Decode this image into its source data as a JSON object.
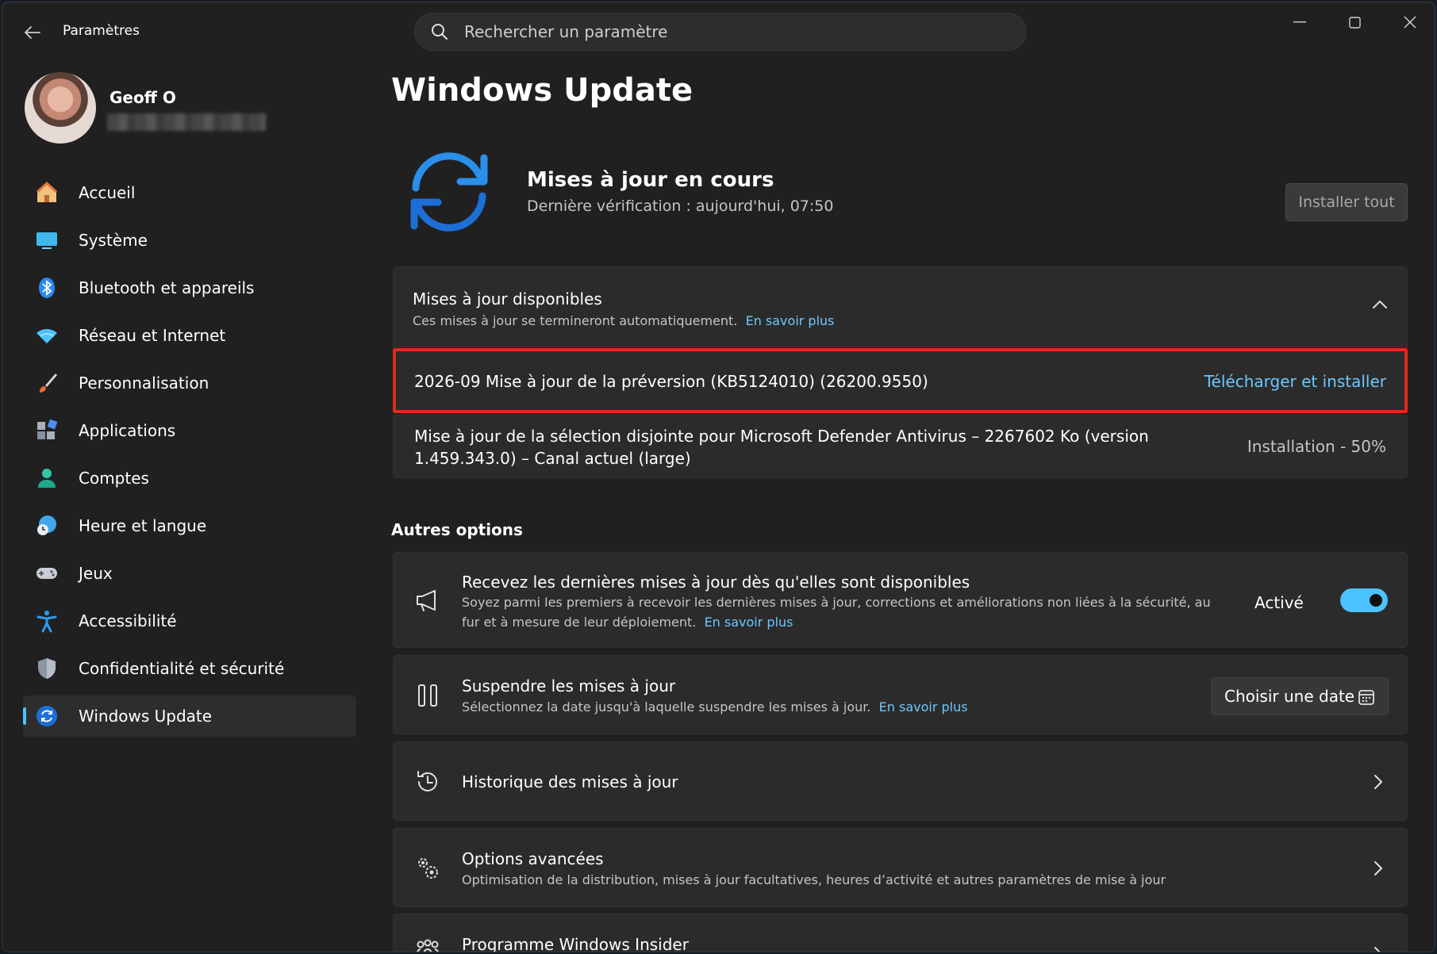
{
  "app": {
    "title": "Paramètres"
  },
  "search": {
    "placeholder": "Rechercher un paramètre"
  },
  "user": {
    "name": "Geoff O"
  },
  "nav": {
    "items": [
      {
        "label": "Accueil",
        "icon": "home-icon"
      },
      {
        "label": "Système",
        "icon": "monitor-icon"
      },
      {
        "label": "Bluetooth et appareils",
        "icon": "bluetooth-icon"
      },
      {
        "label": "Réseau et Internet",
        "icon": "wifi-icon"
      },
      {
        "label": "Personnalisation",
        "icon": "brush-icon"
      },
      {
        "label": "Applications",
        "icon": "apps-icon"
      },
      {
        "label": "Comptes",
        "icon": "person-icon"
      },
      {
        "label": "Heure et langue",
        "icon": "globe-clock-icon"
      },
      {
        "label": "Jeux",
        "icon": "gamepad-icon"
      },
      {
        "label": "Accessibilité",
        "icon": "accessibility-icon"
      },
      {
        "label": "Confidentialité et sécurité",
        "icon": "shield-icon"
      },
      {
        "label": "Windows Update",
        "icon": "update-icon",
        "active": true
      }
    ]
  },
  "main": {
    "title": "Windows Update",
    "status": {
      "title": "Mises à jour en cours",
      "subtitle": "Dernière vérification : aujourd'hui, 07:50",
      "install_all": "Installer tout"
    },
    "available": {
      "title": "Mises à jour disponibles",
      "subtitle": "Ces mises à jour se termineront automatiquement.",
      "learn_more": "En savoir plus",
      "updates": [
        {
          "name": "2026-09 Mise à jour de la préversion (KB5124010) (26200.9550)",
          "action": "Télécharger et installer"
        },
        {
          "name": "Mise à jour de la sélection disjointe pour Microsoft Defender Antivirus – 2267602 Ko (version 1.459.343.0) – Canal actuel (large)",
          "status": "Installation - 50%"
        }
      ]
    },
    "other_options": {
      "title": "Autres options",
      "items": [
        {
          "title": "Recevez les dernières mises à jour dès qu'elles sont disponibles",
          "subtitle": "Soyez parmi les premiers à recevoir les dernières mises à jour, corrections et améliorations non liées à la sécurité, au fur et à mesure de leur déploiement.",
          "learn_more": "En savoir plus",
          "toggle_label": "Activé",
          "toggle_on": true
        },
        {
          "title": "Suspendre les mises à jour",
          "subtitle": "Sélectionnez la date jusqu'à laquelle suspendre les mises à jour.",
          "learn_more": "En savoir plus",
          "button": "Choisir une date"
        },
        {
          "title": "Historique des mises à jour"
        },
        {
          "title": "Options avancées",
          "subtitle": "Optimisation de la distribution, mises à jour facultatives, heures d’activité et autres paramètres de mise à jour"
        },
        {
          "title": "Programme Windows Insider"
        }
      ]
    }
  },
  "colors": {
    "accent": "#4cc2ff",
    "link": "#6cc7ff",
    "highlight": "#e02a1c",
    "background": "#202020",
    "card": "#2b2b2b"
  }
}
